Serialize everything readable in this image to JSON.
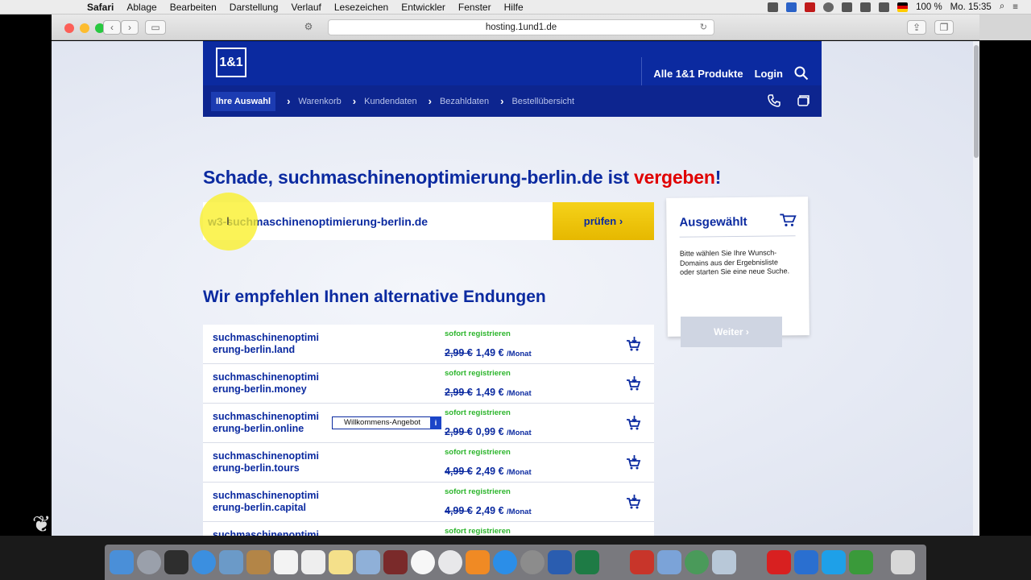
{
  "menubar": {
    "items": [
      "Safari",
      "Ablage",
      "Bearbeiten",
      "Darstellung",
      "Verlauf",
      "Lesezeichen",
      "Entwickler",
      "Fenster",
      "Hilfe"
    ],
    "battery": "100 %",
    "clock": "Mo. 15:35"
  },
  "browser": {
    "url": "hosting.1und1.de"
  },
  "header": {
    "logo": "1&1",
    "products_link": "Alle 1&1 Produkte",
    "login_link": "Login"
  },
  "steps": {
    "items": [
      "Ihre Auswahl",
      "Warenkorb",
      "Kundendaten",
      "Bezahldaten",
      "Bestellübersicht"
    ]
  },
  "headline": {
    "text": "Schade, suchmaschinenoptimierung-berlin.de ist ",
    "highlight": "vergeben",
    "end": "!"
  },
  "search": {
    "value": "w3-suchmaschinenoptimierung-berlin.de",
    "button": "prüfen"
  },
  "subheadline": "Wir empfehlen Ihnen alternative Endungen",
  "results": [
    {
      "line1": "suchmaschinenoptimi",
      "line2": "erung-berlin.land",
      "status": "sofort registrieren",
      "old_price": "2,99 €",
      "price": "1,49 €",
      "unit": "/Monat"
    },
    {
      "line1": "suchmaschinenoptimi",
      "line2": "erung-berlin.money",
      "status": "sofort registrieren",
      "old_price": "2,99 €",
      "price": "1,49 €",
      "unit": "/Monat"
    },
    {
      "line1": "suchmaschinenoptimi",
      "line2": "erung-berlin.online",
      "status": "sofort registrieren",
      "old_price": "2,99 €",
      "price": "0,99 €",
      "unit": "/Monat",
      "badge": "Willkommens-Angebot",
      "badge_info": "i"
    },
    {
      "line1": "suchmaschinenoptimi",
      "line2": "erung-berlin.tours",
      "status": "sofort registrieren",
      "old_price": "4,99 €",
      "price": "2,49 €",
      "unit": "/Monat"
    },
    {
      "line1": "suchmaschinenoptimi",
      "line2": "erung-berlin.capital",
      "status": "sofort registrieren",
      "old_price": "4,99 €",
      "price": "2,49 €",
      "unit": "/Monat"
    },
    {
      "line1": "suchmaschinenoptimi",
      "line2": "",
      "status": "sofort registrieren",
      "old_price": "",
      "price": "",
      "unit": ""
    }
  ],
  "sidebar": {
    "title": "Ausgewählt",
    "text": "Bitte wählen Sie Ihre Wunsch-Domains aus der Ergebnisliste oder starten Sie eine neue Suche.",
    "button": "Weiter"
  },
  "colors": {
    "brand_blue": "#0b2aa0",
    "accent_yellow": "#f5d21a",
    "taken_red": "#e00000",
    "available_green": "#2bb52b"
  }
}
